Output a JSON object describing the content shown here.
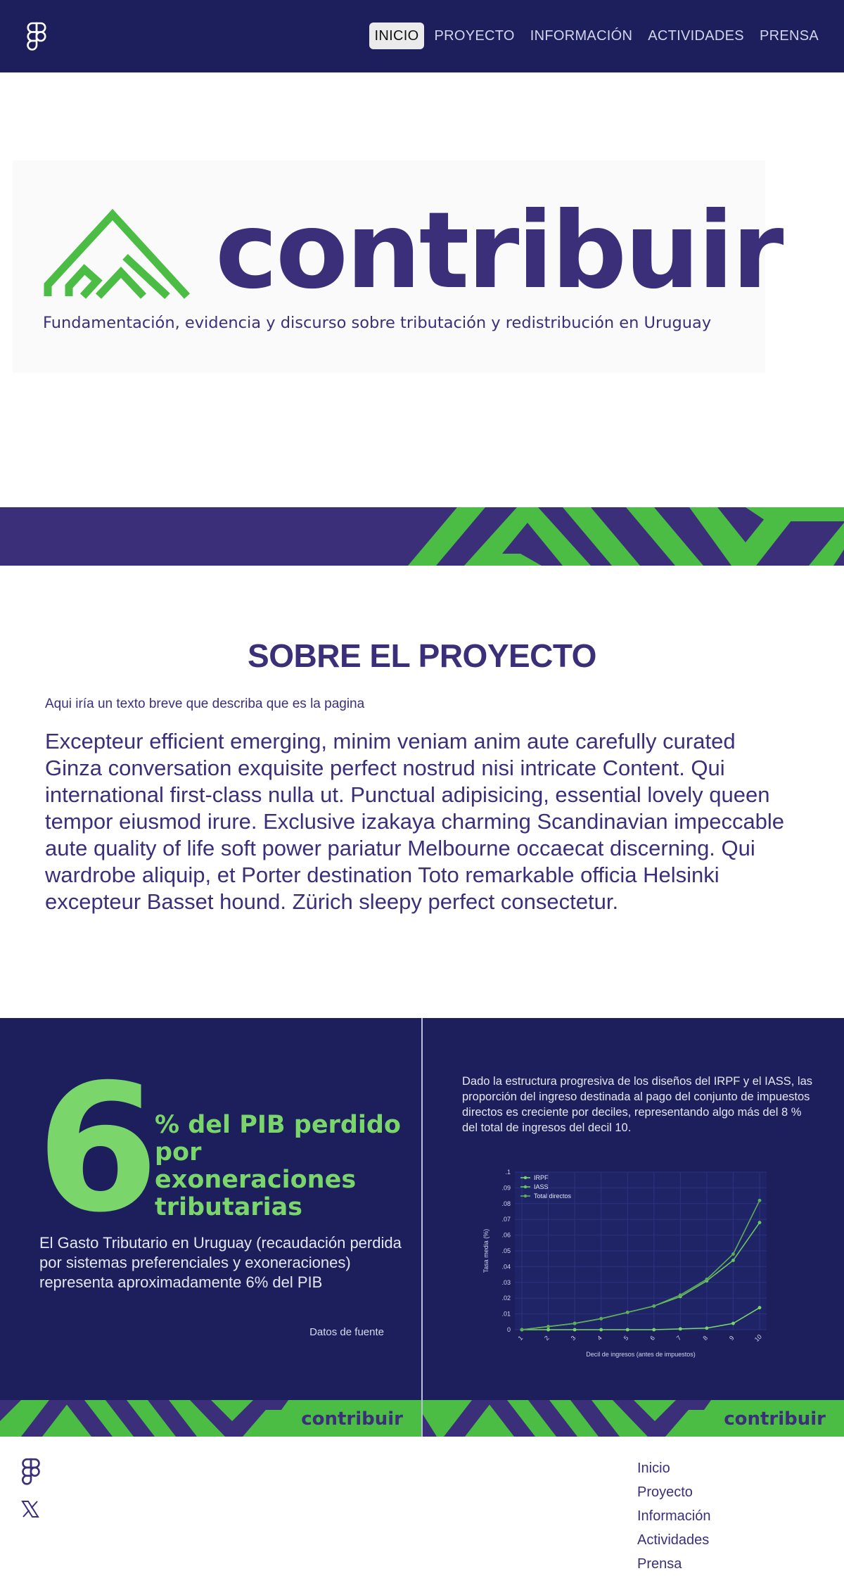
{
  "nav": {
    "items": [
      {
        "label": "INICIO",
        "active": true
      },
      {
        "label": "PROYECTO"
      },
      {
        "label": "INFORMACIÓN"
      },
      {
        "label": "ACTIVIDADES"
      },
      {
        "label": "PRENSA"
      }
    ]
  },
  "hero": {
    "wordmark": "contribuir",
    "tagline": "Fundamentación, evidencia y discurso sobre tributación y redistribución en Uruguay"
  },
  "about": {
    "title": "SOBRE EL PROYECTO",
    "subtitle": "Aqui iría un texto breve que describa que es la pagina",
    "body": "Excepteur efficient emerging, minim veniam anim aute carefully curated Ginza conversation exquisite perfect nostrud nisi intricate Content. Qui  international first-class nulla ut. Punctual adipisicing, essential lovely queen tempor eiusmod irure. Exclusive izakaya charming Scandinavian impeccable aute quality of life soft power pariatur Melbourne occaecat discerning. Qui wardrobe aliquip, et Porter destination Toto remarkable officia Helsinki excepteur Basset hound. Zürich sleepy perfect consectetur."
  },
  "stat_panel": {
    "big_number": "6",
    "headline": "% del PIB perdido por exoneraciones tributarias",
    "body": "El Gasto Tributario en Uruguay (recaudación perdida por sistemas preferenciales y exoneraciones) representa aproximadamente 6% del PIB",
    "source": "Datos de fuente",
    "brand": "contribuir"
  },
  "chart_panel": {
    "description": "Dado la estructura progresiva de los diseños del IRPF y el IASS, las proporción del ingreso destinada al pago del conjunto de impuestos directos es creciente por deciles, representando algo más del 8 % del total de ingresos del decil 10.",
    "brand": "contribuir"
  },
  "chart_data": {
    "type": "line",
    "title": "",
    "xlabel": "Decil de ingresos (antes de impuestos)",
    "ylabel": "Tasa media (%)",
    "x": [
      1,
      2,
      3,
      4,
      5,
      6,
      7,
      8,
      9,
      10
    ],
    "x_tick_labels": [
      "1",
      "2",
      "3",
      "4",
      "5",
      "6",
      "7",
      "8",
      "9",
      "10"
    ],
    "y_tick_labels": [
      "0",
      ".01",
      ".02",
      ".03",
      ".04",
      ".05",
      ".06",
      ".07",
      ".08",
      ".09",
      ".1"
    ],
    "ylim": [
      0,
      0.1
    ],
    "grid": true,
    "legend_position": "top-left",
    "series": [
      {
        "name": "IRPF",
        "values": [
          0.0,
          0.0,
          0.0,
          0.0,
          0.0,
          0.0,
          0.0005,
          0.001,
          0.004,
          0.014
        ]
      },
      {
        "name": "IASS",
        "values": [
          0.0,
          0.002,
          0.004,
          0.007,
          0.011,
          0.015,
          0.021,
          0.031,
          0.044,
          0.068
        ]
      },
      {
        "name": "Total directos",
        "values": [
          0.0,
          0.002,
          0.004,
          0.007,
          0.011,
          0.015,
          0.022,
          0.032,
          0.048,
          0.082
        ]
      }
    ],
    "colors": [
      "#7ad66b",
      "#6cc462",
      "#5fae57"
    ]
  },
  "footer": {
    "links": [
      "Inicio",
      "Proyecto",
      "Información",
      "Actividades",
      "Prensa"
    ]
  },
  "colors": {
    "navy": "#1c1f5c",
    "purple": "#3b2f7a",
    "green": "#4bbd45",
    "light_green": "#7ad66b"
  },
  "icons": [
    "figma-logo-icon",
    "contribuir-logo-mark",
    "x-twitter-icon"
  ]
}
